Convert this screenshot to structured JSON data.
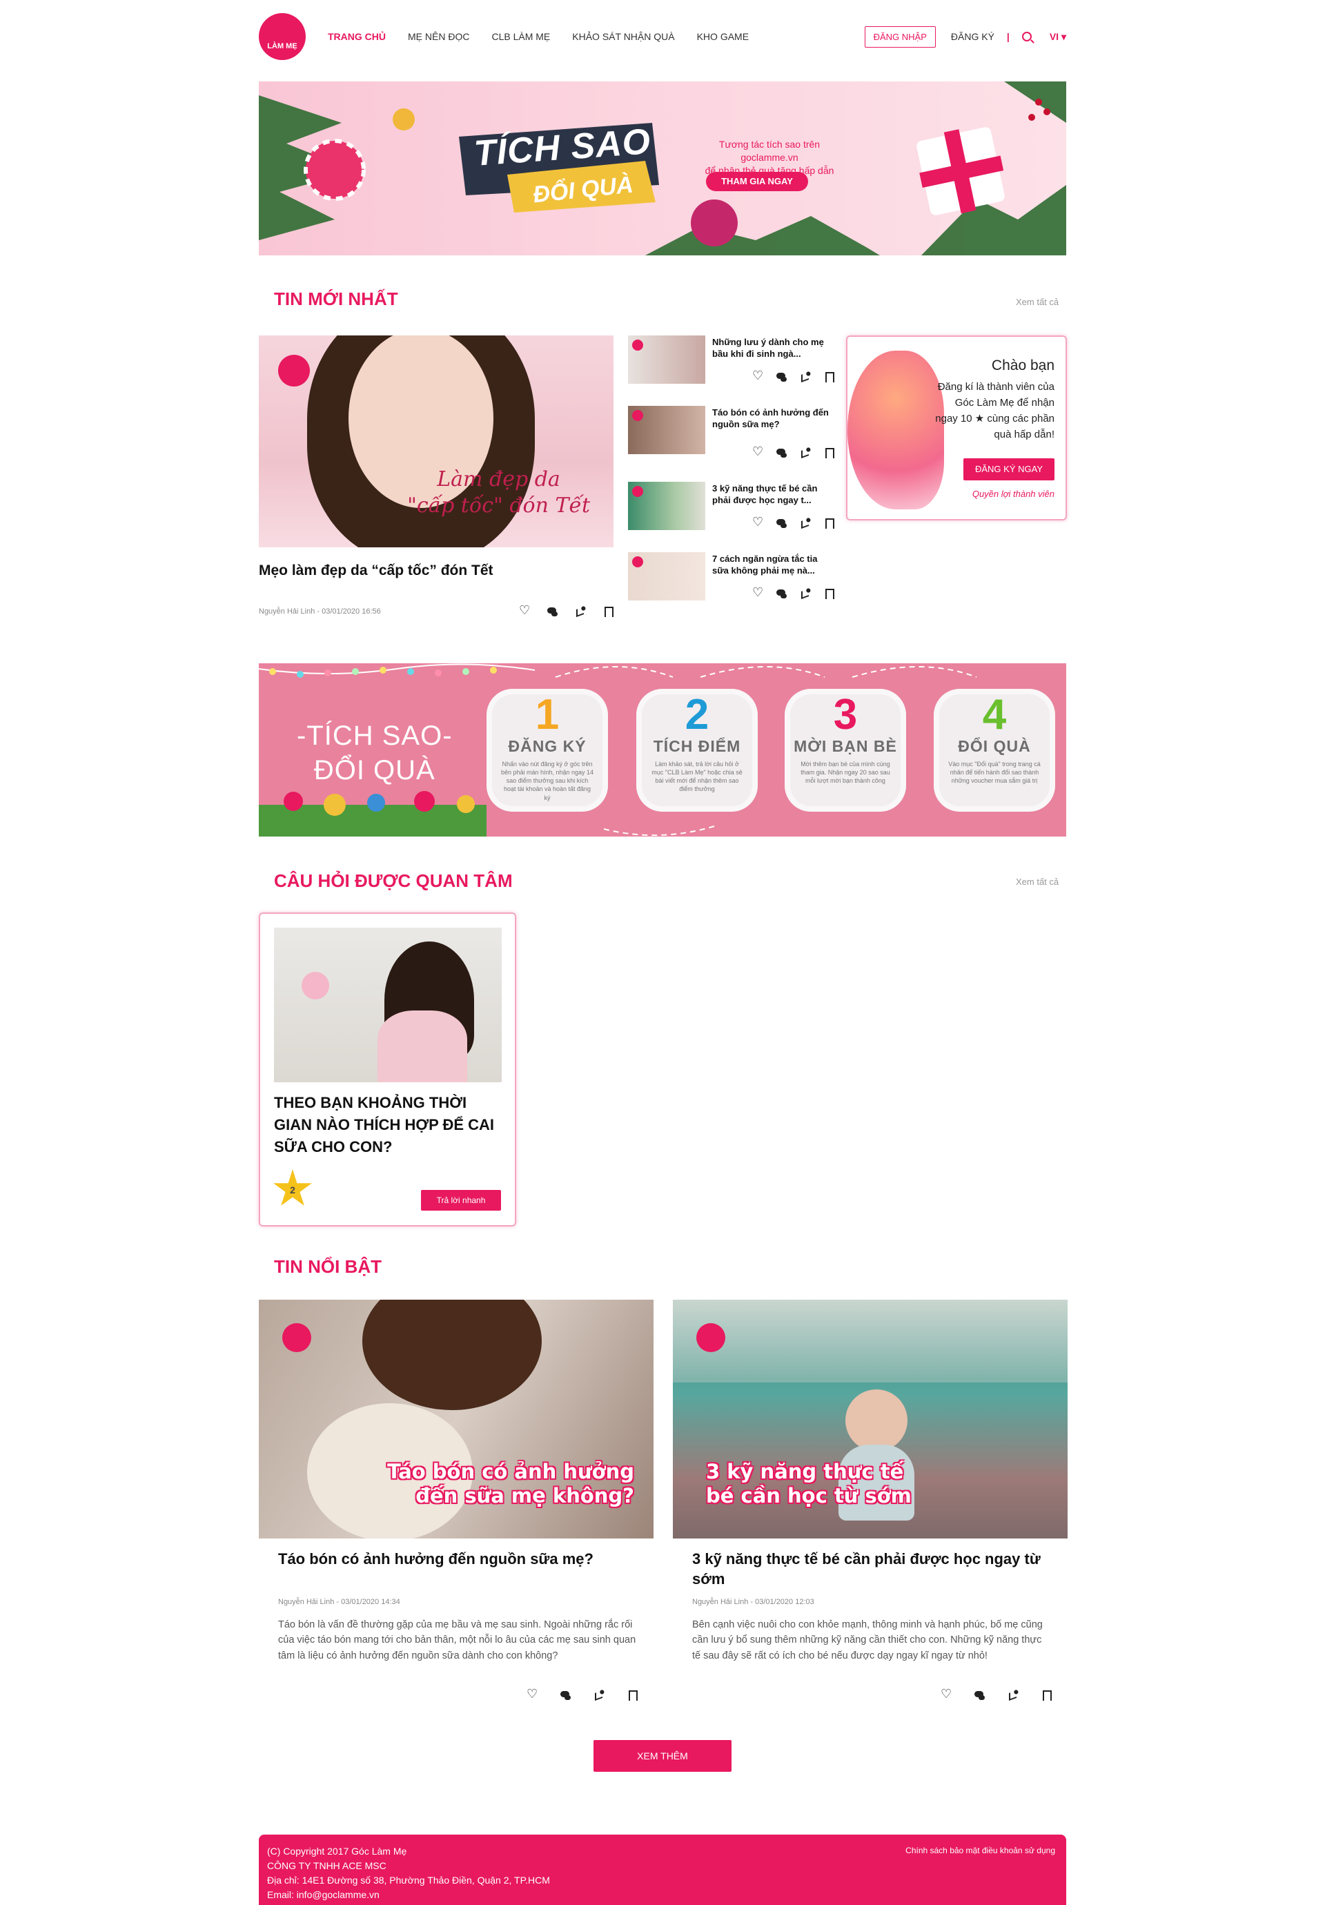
{
  "header": {
    "logo_text": "LÀM MẸ",
    "nav": [
      "TRANG CHỦ",
      "MẸ NÊN ĐỌC",
      "CLB LÀM MẸ",
      "KHẢO SÁT NHẬN QUÀ",
      "KHO GAME"
    ],
    "login": "ĐĂNG NHẬP",
    "register": "ĐĂNG KÝ",
    "separator": "|",
    "lang": "VI ▾"
  },
  "banner1": {
    "title_line1": "TÍCH SAO",
    "title_line2": "ĐỔI QUÀ",
    "subtitle_line1": "Tương tác tích sao trên goclamme.vn",
    "subtitle_line2": "để nhận thẻ quà tặng hấp dẫn",
    "cta": "THAM GIA NGAY"
  },
  "latest": {
    "title": "TIN MỚI NHẤT",
    "see_all": "Xem tất cả",
    "feature": {
      "caption_line1": "Làm đẹp da",
      "caption_line2": "\"cấp tốc\" đón Tết",
      "title": "Mẹo làm đẹp da “cấp tốc” đón Tết",
      "meta": "Nguyễn Hải Linh - 03/01/2020 16:56"
    },
    "items": [
      {
        "title": "Những lưu ý dành cho mẹ bầu khi đi sinh ngà..."
      },
      {
        "title": "Táo bón có ảnh hưởng đến nguồn sữa mẹ?"
      },
      {
        "title": "3 kỹ năng thực tế bé cần phải được học ngay t..."
      },
      {
        "title": "7 cách ngăn ngừa tắc tia sữa không phải mẹ nà..."
      }
    ]
  },
  "welcome": {
    "hello": "Chào bạn",
    "text1": "Đăng kí là thành viên của",
    "text2": "Góc Làm Mẹ để nhận",
    "text3": "ngay 10 ★ cùng các phần",
    "text4": "quà hấp dẫn!",
    "cta": "ĐĂNG KÝ NGAY",
    "link": "Quyền lợi thành viên"
  },
  "banner2": {
    "title_line1": "-TÍCH SAO-",
    "title_line2": "ĐỔI QUÀ",
    "steps": [
      {
        "num": "1",
        "label": "ĐĂNG KÝ",
        "desc": "Nhấn vào nút đăng ký ở góc trên bên phải màn hình, nhận ngay 14 sao điểm thưởng sau khi kích hoạt tài khoản và hoàn tất đăng ký",
        "color": "#f5a623"
      },
      {
        "num": "2",
        "label": "TÍCH ĐIỂM",
        "desc": "Làm khảo sát, trả lời câu hỏi ở mục \"CLB Làm Mẹ\" hoặc chia sẻ bài viết mới để nhận thêm sao điểm thưởng",
        "color": "#1e9bd7"
      },
      {
        "num": "3",
        "label": "MỜI BẠN BÈ",
        "desc": "Mời thêm bạn bè của mình cùng tham gia. Nhận ngay 20 sao sau mỗi lượt mời bạn thành công",
        "color": "#e8195f"
      },
      {
        "num": "4",
        "label": "ĐỔI QUÀ",
        "desc": "Vào mục \"Đổi quà\" trong trang cá nhân để tiến hành đổi sao thành những voucher mua sắm giá trị",
        "color": "#6abf2e"
      }
    ]
  },
  "questions": {
    "title": "CÂU HỎI ĐƯỢC QUAN TÂM",
    "see_all": "Xem tất cả",
    "card": {
      "title": "THEO BẠN KHOẢNG THỜI GIAN NÀO THÍCH HỢP ĐỂ CAI SỮA CHO CON?",
      "stars": "2",
      "cta": "Trả lời nhanh"
    }
  },
  "outstanding": {
    "title": "TIN NỔI BẬT",
    "cards": [
      {
        "overlay_line1": "Táo bón có ảnh hưởng",
        "overlay_line2": "đến sữa mẹ không?",
        "title": "Táo bón có ảnh hưởng đến nguồn sữa mẹ?",
        "meta": "Nguyễn Hải Linh - 03/01/2020 14:34",
        "desc": "Táo bón là vấn đề thường gặp của mẹ bầu và mẹ sau sinh. Ngoài những rắc rối của việc táo bón mang tới cho bản thân, một nỗi lo âu của các mẹ sau sinh quan tâm là liệu có ảnh hưởng đến nguồn sữa dành cho con không?"
      },
      {
        "overlay_line1": "3 kỹ năng thực tế",
        "overlay_line2": "bé cần học từ sớm",
        "title": "3 kỹ năng thực tế bé cần phải được học ngay từ sớm",
        "meta": "Nguyễn Hải Linh - 03/01/2020 12:03",
        "desc": "Bên cạnh việc nuôi cho con khỏe mạnh, thông minh và hạnh phúc, bố mẹ cũng cần lưu ý bổ sung thêm những kỹ năng cần thiết cho con. Những kỹ năng thực tế sau đây sẽ rất có ích cho bé nếu được dạy ngay kĩ ngay từ nhỏ!"
      }
    ],
    "more": "XEM THÊM"
  },
  "footer": {
    "copyright": "(C) Copyright 2017 Góc Làm Mẹ",
    "company": "CÔNG TY TNHH ACE MSC",
    "address": "Địa chỉ: 14E1 Đường số 38, Phường Thảo Điền, Quận 2, TP.HCM",
    "email": "Email: info@goclamme.vn",
    "links": "Chính sách bảo mật   điều khoản sử dụng"
  },
  "colors": {
    "brand": "#e8195f"
  }
}
